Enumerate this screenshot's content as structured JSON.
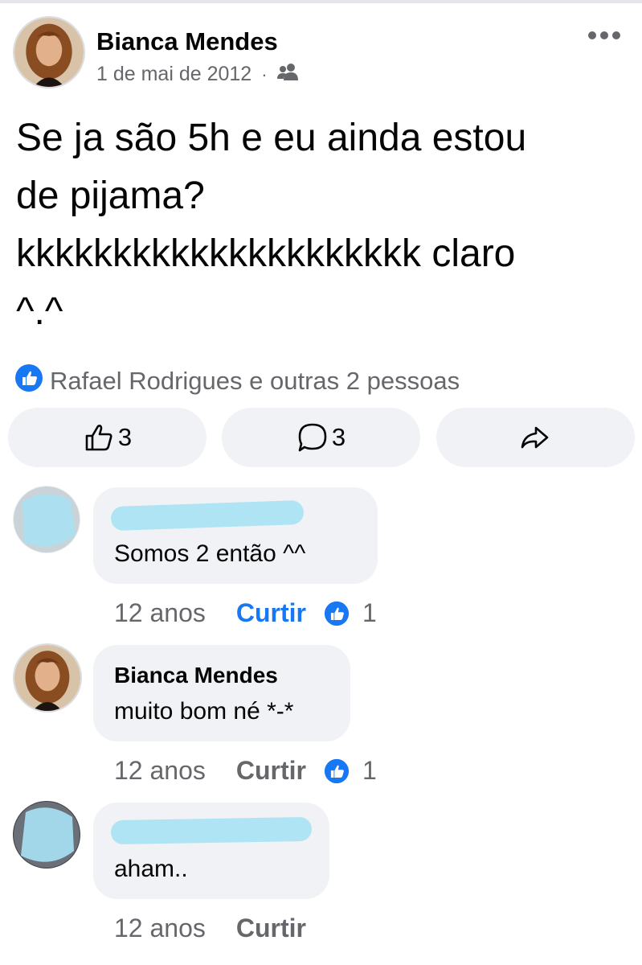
{
  "post": {
    "author": "Bianca Mendes",
    "date": "1 de mai de 2012",
    "separator": "·",
    "audience_icon": "friends-icon",
    "more_icon": "more-options-icon",
    "text_lines": [
      "Se ja são 5h e eu ainda estou",
      "de pijama?",
      "kkkkkkkkkkkkkkkkkkkkk claro",
      "^.^"
    ]
  },
  "reactions": {
    "icon": "like-badge-icon",
    "summary": "Rafael Rodrigues e outras 2 pessoas"
  },
  "actions": {
    "like_count": "3",
    "comment_count": "3",
    "share_icon": "share-icon"
  },
  "comments": [
    {
      "author": "",
      "text": "Somos 2 então    ^^",
      "time": "12 anos",
      "like_label": "Curtir",
      "liked": true,
      "reaction_count": "1"
    },
    {
      "author": "Bianca Mendes",
      "text": "muito bom né *-*",
      "time": "12 anos",
      "like_label": "Curtir",
      "liked": false,
      "reaction_count": "1"
    },
    {
      "author": "",
      "text": "aham..",
      "time": "12 anos",
      "like_label": "Curtir",
      "liked": false,
      "reaction_count": ""
    }
  ],
  "colors": {
    "accent": "#1877f2",
    "secondary_text": "#65676b",
    "bubble": "#f0f2f5",
    "redaction": "#a7e2f4"
  }
}
